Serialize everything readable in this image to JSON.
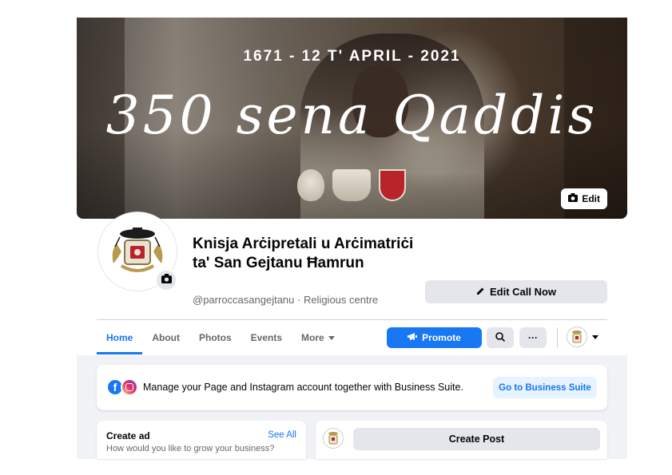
{
  "cover": {
    "date_line": "1671 - 12 T' APRIL - 2021",
    "title_line": "350 sena Qaddis",
    "edit_label": "Edit"
  },
  "profile": {
    "name": "Knisja Arċipretali u Arċimatriċi ta' San Gejtanu Ħamrun",
    "handle_category": "@parroccasangejtanu · Religious centre",
    "edit_cta_label": "Edit Call Now"
  },
  "tabs": [
    {
      "label": "Home",
      "active": true
    },
    {
      "label": "About",
      "active": false
    },
    {
      "label": "Photos",
      "active": false
    },
    {
      "label": "Events",
      "active": false
    },
    {
      "label": "More",
      "active": false
    }
  ],
  "actions": {
    "promote_label": "Promote",
    "more_label": "···"
  },
  "business_suite": {
    "text": "Manage your Page and Instagram account together with Business Suite.",
    "button_label": "Go to Business Suite"
  },
  "create_ad": {
    "title": "Create ad",
    "see_all": "See All",
    "subtitle": "How would you like to grow your business?"
  },
  "create_post": {
    "button_label": "Create Post"
  },
  "colors": {
    "accent": "#1877f2",
    "button_grey": "#e4e6eb",
    "feed_bg": "#f0f2f5",
    "crest_red": "#b9232a"
  }
}
